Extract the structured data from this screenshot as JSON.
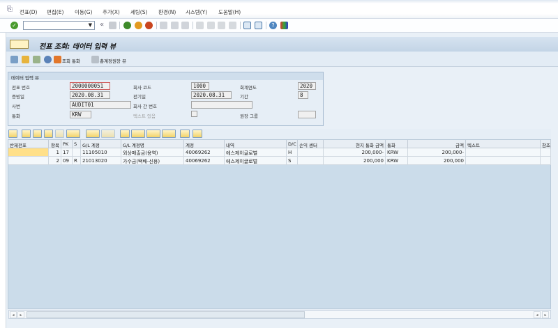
{
  "menu": [
    "전표(D)",
    "편집(E)",
    "이동(G)",
    "추가(X)",
    "세팅(S)",
    "환경(N)",
    "시스템(Y)",
    "도움말(H)"
  ],
  "toolbar": {
    "command_value": "",
    "back_label": "«"
  },
  "title": "전표 조회: 데이터 입력 뷰",
  "app_toolbar": {
    "display_currency": "조회 통화",
    "ledger_view": "총계정원장 뷰"
  },
  "group": {
    "title": "데이터 입력 뷰",
    "fields": [
      {
        "label": "전표 번호",
        "value": "2000000051"
      },
      {
        "label": "회사 코드",
        "value": "1000"
      },
      {
        "label": "회계연도",
        "value": "2020"
      },
      {
        "label": "증빙일",
        "value": "2020.08.31"
      },
      {
        "label": "전기일",
        "value": "2020.08.31"
      },
      {
        "label": "기간",
        "value": "8"
      },
      {
        "label": "사번",
        "value": "AUDIT01"
      },
      {
        "label": "회사 간 번호",
        "value": ""
      },
      {
        "label": "통화",
        "value": "KRW"
      },
      {
        "label": "텍스트 있음",
        "value": ""
      },
      {
        "label": "원장 그룹",
        "value": ""
      }
    ]
  },
  "table": {
    "columns": [
      "반제전표",
      "항목",
      "PK",
      "S",
      "G/L 계정",
      "G/L 계정명",
      "계정",
      "내역",
      "D/C",
      "손익 센터",
      "현지 통화 금액",
      "통화",
      "금액",
      "텍스트",
      "참조"
    ],
    "rows": [
      [
        "",
        "1",
        "17",
        "",
        "11105010",
        "외상매출금(용역)",
        "40069262",
        "에스제이글로벌",
        "H",
        "",
        "200,000-",
        "KRW",
        "200,000-",
        "",
        ""
      ],
      [
        "",
        "2",
        "09",
        "R",
        "21013020",
        "가수금(택배-신용)",
        "40069262",
        "에스제이글로벌",
        "S",
        "",
        "200,000",
        "KRW",
        "200,000",
        "",
        ""
      ]
    ]
  },
  "colors": {
    "title_bar": "#c9d9ea",
    "background": "#e9f0f7",
    "highlight_cell": "#ffe08a"
  }
}
